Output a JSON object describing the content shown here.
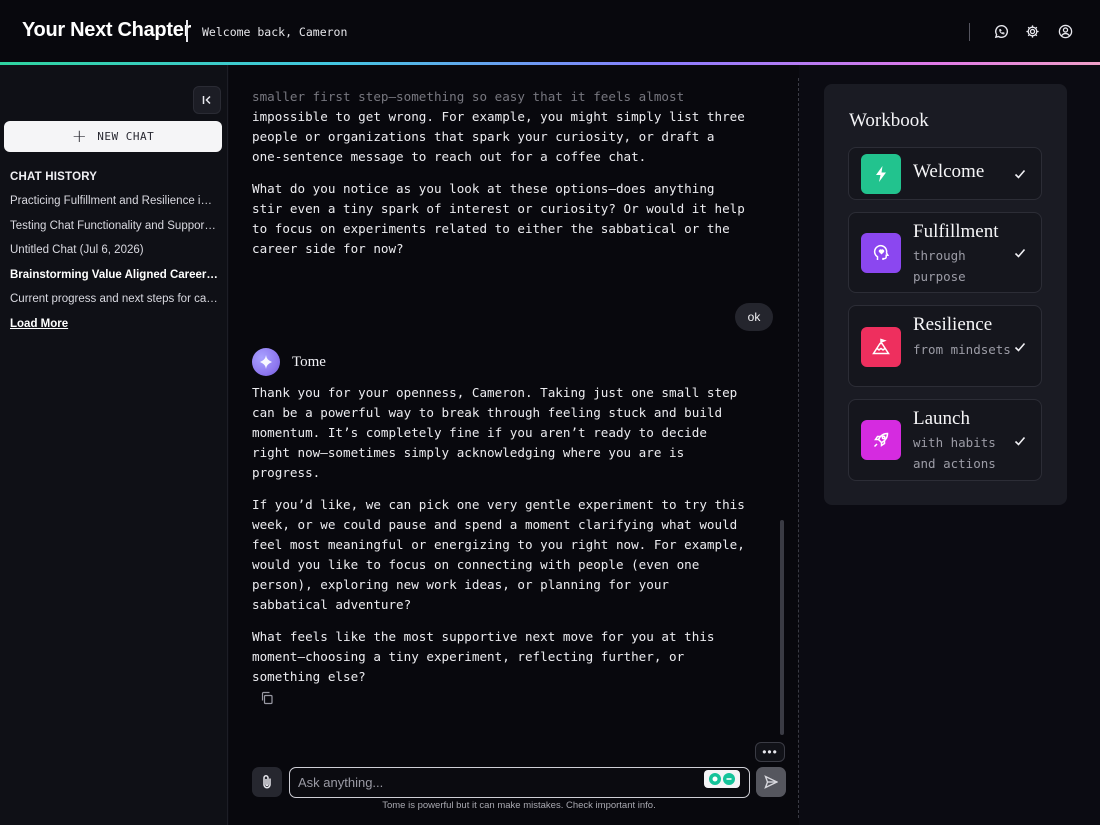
{
  "header": {
    "app_title": "Your Next Chapter",
    "welcome": "Welcome back, Cameron",
    "icons": [
      "chat-bubble-icon",
      "gear-icon",
      "user-circle-icon"
    ]
  },
  "sidebar": {
    "new_chat_label": "NEW CHAT",
    "history_title": "CHAT HISTORY",
    "items": [
      {
        "label": "Practicing Fulfillment and Resilience in Career Transitions",
        "active": false
      },
      {
        "label": "Testing Chat Functionality and Support Options",
        "active": false
      },
      {
        "label": "Untitled Chat (Jul 6, 2026)",
        "active": false
      },
      {
        "label": "Brainstorming Value Aligned Career Experiments",
        "active": true
      },
      {
        "label": "Current progress and next steps for career change",
        "active": false
      }
    ],
    "load_more": "Load More"
  },
  "chat": {
    "assistant_msg_top": {
      "faded_line": "smaller first step—something so easy that it feels almost",
      "text_1": "impossible to get wrong. For example, you might simply list three people or organizations that spark your curiosity, or draft a one-sentence message to reach out for a coffee chat.",
      "text_2": "What do you notice as you look at these options—does anything stir even a tiny spark of interest or curiosity? Or would it help to focus on experiments related to either the sabbatical or the career side for now?"
    },
    "user_msg": "ok",
    "bot_name": "Tome",
    "assistant_msg": {
      "p1": "Thank you for your openness, Cameron. Taking just one small step can be a powerful way to break through feeling stuck and build momentum. It’s completely fine if you aren’t ready to decide right now—sometimes simply acknowledging where you are is progress.",
      "p2": "If you’d like, we can pick one very gentle experiment to try this week, or we could pause and spend a moment clarifying what would feel most meaningful or energizing to you right now. For example, would you like to focus on connecting with people (even one person), exploring new work ideas, or planning for your sabbatical adventure?",
      "p3": "What feels like the most supportive next move for you at this moment—choosing a tiny experiment, reflecting further, or something else?"
    },
    "more_label": "•••",
    "input_placeholder": "Ask anything...",
    "disclaimer": "Tome is powerful but it can make mistakes. Check important info."
  },
  "workbook": {
    "title": "Workbook",
    "cards": [
      {
        "name": "Welcome",
        "subtitle": "",
        "icon": "lightning-icon",
        "color": "#22c38e",
        "completed": true
      },
      {
        "name": "Fulfillment",
        "subtitle": "through purpose",
        "icon": "head-heart-icon",
        "color": "#8b47f0",
        "completed": true
      },
      {
        "name": "Resilience",
        "subtitle": "from mindsets",
        "icon": "mountain-flag-icon",
        "color": "#ee2f5e",
        "completed": true
      },
      {
        "name": "Launch",
        "subtitle": "with habits and actions",
        "icon": "rocket-icon",
        "color": "#d52be0",
        "completed": true
      }
    ]
  }
}
